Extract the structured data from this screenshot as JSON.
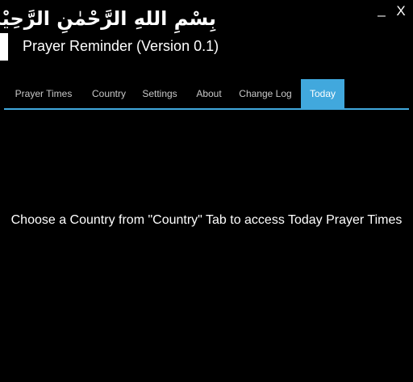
{
  "header": {
    "bismillah": "بِسْمِ اللهِ الرَّحْمٰنِ الرَّحِيْمِ",
    "app_title": "Prayer Reminder (Version 0.1)",
    "minimize_label": "_",
    "close_label": "X"
  },
  "tabs": [
    {
      "label": "Prayer Times",
      "active": false
    },
    {
      "label": "Country",
      "active": false
    },
    {
      "label": "Settings",
      "active": false
    },
    {
      "label": "About",
      "active": false
    },
    {
      "label": "Change Log",
      "active": false
    },
    {
      "label": "Today",
      "active": true
    }
  ],
  "content": {
    "message": "Choose a Country from \"Country\" Tab to access Today Prayer Times"
  },
  "colors": {
    "accent": "#41a8dd",
    "background": "#000000",
    "text": "#ffffff",
    "tab_text": "#c8c8c8"
  }
}
